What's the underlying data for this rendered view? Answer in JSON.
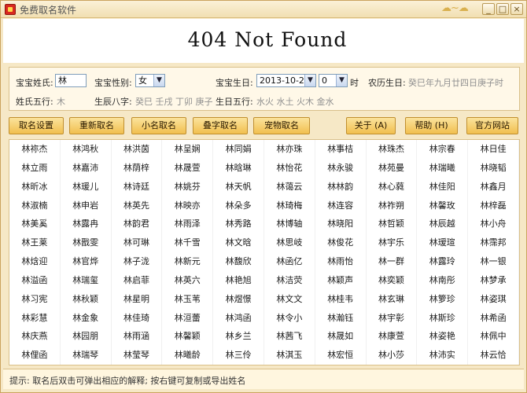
{
  "window": {
    "title": "免费取名软件",
    "buttons": [
      "_",
      "□",
      "×"
    ]
  },
  "banner": {
    "title": "404 Not Found"
  },
  "form": {
    "surname_label": "宝宝姓氏:",
    "surname_value": "林",
    "gender_label": "宝宝性别:",
    "gender_value": "女",
    "birthday_label": "宝宝生日:",
    "birthday_value": "2013-10-28",
    "hour_value": "0",
    "hour_unit": "时",
    "lunar_label": "农历生日:",
    "lunar_value": "癸巳年九月廿四日庚子时",
    "wuxing_label": "姓氏五行:",
    "wuxing_value": "木",
    "bazi_label": "生辰八字:",
    "bazi_value": "癸巳 壬戌 丁卯 庚子",
    "birth_wuxing_label": "生日五行:",
    "birth_wuxing_value": "水火 水土 火木 金水"
  },
  "toolbar": {
    "settings": "取名设置",
    "rename": "重新取名",
    "nickname": "小名取名",
    "double": "叠字取名",
    "pet": "宠物取名",
    "about": "关于 (A)",
    "help": "帮助 (H)",
    "website": "官方网站"
  },
  "names": [
    [
      "林祢杰",
      "林鸿秋",
      "林洪茵",
      "林呈娴",
      "林同娟",
      "林亦珠",
      "林事桔",
      "林珠杰",
      "林宗春",
      "林日佳"
    ],
    [
      "林立雨",
      "林嘉沛",
      "林荫梓",
      "林晟萱",
      "林晗琳",
      "林怡花",
      "林永骏",
      "林苑曼",
      "林瑞曦",
      "林晓韬"
    ],
    [
      "林昕冰",
      "林瑗儿",
      "林诗廷",
      "林姚芬",
      "林天帆",
      "林蔼云",
      "林林韵",
      "林心蕤",
      "林佳阳",
      "林鑫月"
    ],
    [
      "林淑楠",
      "林申岩",
      "林英先",
      "林映亦",
      "林朵多",
      "林琦梅",
      "林连容",
      "林祚朔",
      "林馨玫",
      "林梓磊"
    ],
    [
      "林美奚",
      "林露冉",
      "林韵君",
      "林雨泽",
      "林秀路",
      "林博轴",
      "林晓阳",
      "林哲颖",
      "林辰越",
      "林小舟"
    ],
    [
      "林王莱",
      "林戬雯",
      "林可琳",
      "林千雪",
      "林文晗",
      "林思岐",
      "林俊花",
      "林宇乐",
      "林瑷瑄",
      "林霈邦"
    ],
    [
      "林焓迎",
      "林官烨",
      "林子泷",
      "林新元",
      "林馥欣",
      "林函亿",
      "林雨怡",
      "林一群",
      "林露玲",
      "林一银"
    ],
    [
      "林溢函",
      "林瑞玺",
      "林启菲",
      "林英六",
      "林艳旭",
      "林洁荧",
      "林颖声",
      "林奕颖",
      "林南彤",
      "林梦承"
    ],
    [
      "林习宪",
      "林秋颖",
      "林星明",
      "林玉苇",
      "林煜憬",
      "林文文",
      "林桂韦",
      "林玄琳",
      "林箩珍",
      "林姿琪"
    ],
    [
      "林彩慧",
      "林金象",
      "林佳琦",
      "林洹蕾",
      "林鸿函",
      "林令小",
      "林瀚钰",
      "林宇彰",
      "林斯珍",
      "林希函"
    ],
    [
      "林庆燕",
      "林园朋",
      "林雨涵",
      "林馨颖",
      "林乡兰",
      "林茜飞",
      "林晟如",
      "林康萱",
      "林姿艳",
      "林佩中"
    ],
    [
      "林俚函",
      "林瑞琴",
      "林莹琴",
      "林曦龄",
      "林三伶",
      "林淇玉",
      "林宏恒",
      "林小莎",
      "林沛实",
      "林云恰"
    ]
  ],
  "status": {
    "text": "提示: 取名后双击可弹出相应的解释; 按右键可复制或导出姓名"
  }
}
